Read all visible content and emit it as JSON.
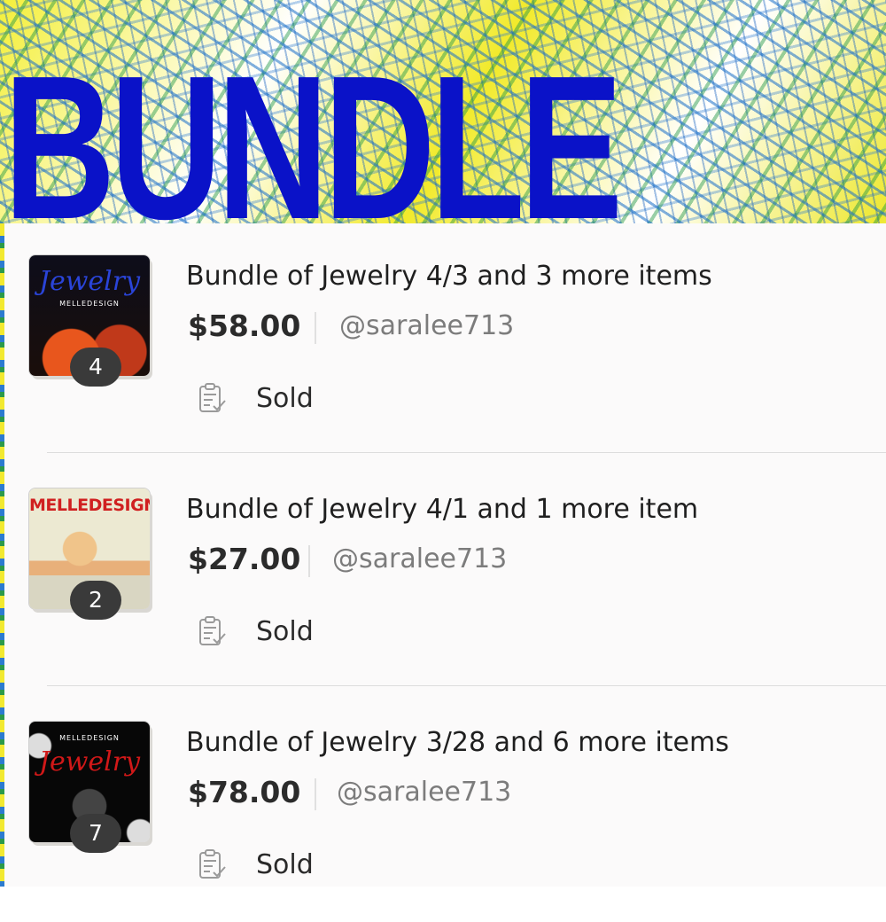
{
  "banner": {
    "title": "BUNDLE"
  },
  "listings": [
    {
      "title": "Bundle of Jewelry 4/3 and 3 more items",
      "price": "$58.00",
      "seller": "@saralee713",
      "status": "Sold",
      "item_count": "4",
      "thumb_script": "Jewelry",
      "thumb_brand": "MELLEDESIGN"
    },
    {
      "title": "Bundle of Jewelry 4/1 and 1 more item",
      "price": "$27.00",
      "seller": "@saralee713",
      "status": "Sold",
      "item_count": "2",
      "thumb_brand": "MELLEDESIGN"
    },
    {
      "title": "Bundle of Jewelry 3/28 and 6 more items",
      "price": "$78.00",
      "seller": "@saralee713",
      "status": "Sold",
      "item_count": "7",
      "thumb_script": "Jewelry",
      "thumb_brand": "MELLEDESIGN"
    }
  ],
  "icons": {
    "status": "clipboard-check-icon"
  },
  "colors": {
    "banner_text": "#0a12c8",
    "panel_bg": "#fbfafa",
    "badge_bg": "#3a3a3a"
  }
}
